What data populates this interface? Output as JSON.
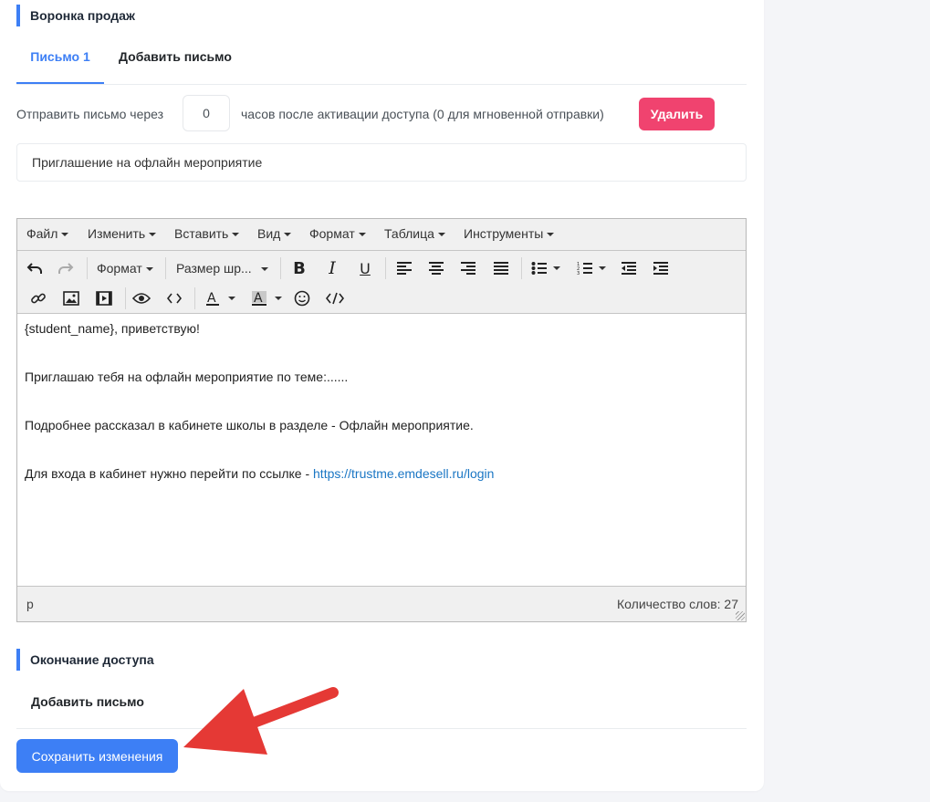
{
  "funnel": {
    "section_title": "Воронка продаж",
    "tabs": [
      {
        "label": "Письмо 1",
        "active": true
      },
      {
        "label": "Добавить письмо",
        "active": false
      }
    ],
    "delay": {
      "prefix": "Отправить письмо через",
      "value": "0",
      "suffix": "часов после активации доступа (0 для мгновенной отправки)"
    },
    "delete_label": "Удалить",
    "subject_value": "Приглашение на офлайн мероприятие"
  },
  "editor": {
    "menu": [
      "Файл",
      "Изменить",
      "Вставить",
      "Вид",
      "Формат",
      "Таблица",
      "Инструменты"
    ],
    "toolbar": {
      "format_dropdown": "Формат",
      "size_dropdown": "Размер шр..."
    },
    "content": {
      "line1": "{student_name}, приветствую!",
      "line2": "Приглашаю тебя на офлайн мероприятие по теме:......",
      "line3": "Подробнее рассказал в кабинете школы в разделе - Офлайн мероприятие.",
      "line4_text": "Для входа в кабинет нужно перейти по ссылке - ",
      "line4_link": "https://trustme.emdesell.ru/login"
    },
    "status": {
      "path": "p",
      "word_count": "Количество слов: 27"
    }
  },
  "access_end": {
    "section_title": "Окончание доступа",
    "add_letter_label": "Добавить письмо"
  },
  "save_label": "Сохранить изменения",
  "colors": {
    "accent": "#3d7ff5",
    "danger": "#f0436f",
    "annotation_arrow": "#e53935"
  }
}
